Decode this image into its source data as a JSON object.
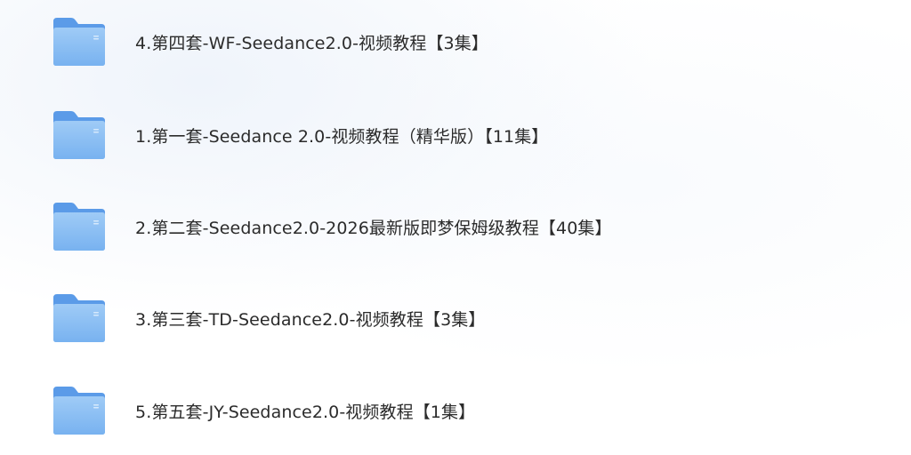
{
  "colors": {
    "folder_back": "#5b9be8",
    "folder_front_top": "#9fcbf6",
    "folder_front_bottom": "#78b2f0",
    "folder_mark": "#d6e9fc",
    "text": "#2b2b2b"
  },
  "folders": [
    {
      "name": "4.第四套-WF-Seedance2.0-视频教程【3集】",
      "icon": "folder-icon"
    },
    {
      "name": "1.第一套-Seedance 2.0-视频教程（精华版）【11集】",
      "icon": "folder-icon"
    },
    {
      "name": "2.第二套-Seedance2.0-2026最新版即梦保姆级教程【40集】",
      "icon": "folder-icon"
    },
    {
      "name": "3.第三套-TD-Seedance2.0-视频教程【3集】",
      "icon": "folder-icon"
    },
    {
      "name": "5.第五套-JY-Seedance2.0-视频教程【1集】",
      "icon": "folder-icon"
    }
  ]
}
